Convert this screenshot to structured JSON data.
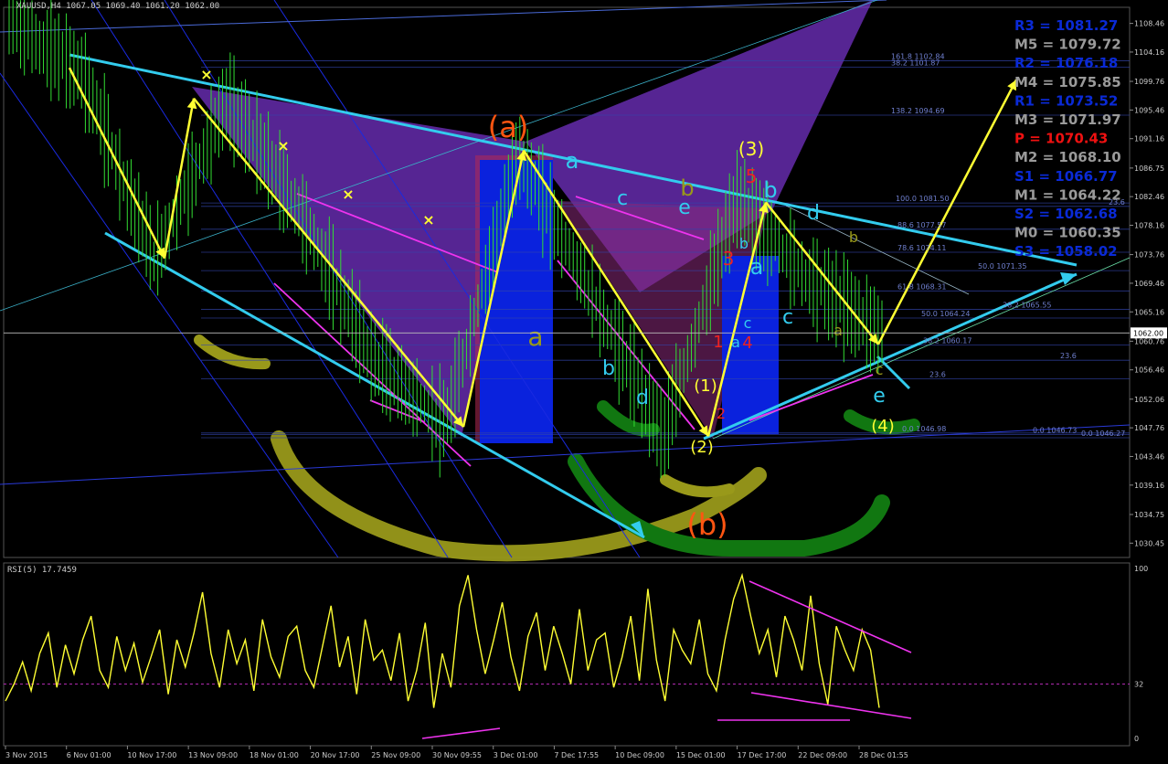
{
  "colors": {
    "background": "#000000",
    "candle": "#33dd33",
    "fib_line": "#3344aa",
    "wave_yellow": "#ffff33",
    "channel_cyan": "#33ccee",
    "magenta": "#ee33ee",
    "purple_fill": "#7733cc",
    "blue_fill": "#0a22dd",
    "olive": "#99991a",
    "dark_green": "#117711",
    "orange": "#ff5511",
    "red": "#ee2222",
    "axis_text": "#cccccc",
    "pivot_blue": "#0a2ad6",
    "pivot_gray": "#9a9a9a",
    "pivot_red": "#ee1111"
  },
  "main": {
    "header": "XAUUSD,H4  1067.05 1069.40 1061.20 1062.00",
    "current_price_label": "1062.00",
    "price_axis_labels": [
      "1108.46",
      "1104.16",
      "1099.76",
      "1095.46",
      "1091.16",
      "1086.75",
      "1082.46",
      "1078.16",
      "1073.76",
      "1069.46",
      "1065.16",
      "1060.76",
      "1056.46",
      "1052.06",
      "1047.76",
      "1043.46",
      "1039.16",
      "1034.75",
      "1030.45"
    ],
    "time_axis_labels": [
      "3 Nov 2015",
      "6 Nov 01:00",
      "10 Nov 17:00",
      "13 Nov 09:00",
      "18 Nov 01:00",
      "20 Nov 17:00",
      "25 Nov 09:00",
      "30 Nov 09:55",
      "3 Dec 01:00",
      "7 Dec 17:55",
      "10 Dec 09:00",
      "15 Dec 01:00",
      "17 Dec 17:00",
      "22 Dec 09:00",
      "28 Dec 01:55"
    ]
  },
  "fib_labels": [
    {
      "text": "161.8 1102.84",
      "price": 1102.84
    },
    {
      "text": "38.2 1101.87",
      "price": 1101.87
    },
    {
      "text": "138.2 1094.69",
      "price": 1094.69
    },
    {
      "text": "100.0 1081.50",
      "price": 1081.5
    },
    {
      "text": "23.6",
      "price": 1081.0
    },
    {
      "text": "88.6 1077.57",
      "price": 1077.57
    },
    {
      "text": "78.6 1074.11",
      "price": 1074.11
    },
    {
      "text": "50.0 1071.35",
      "price": 1071.35
    },
    {
      "text": "61.8 1068.31",
      "price": 1068.31
    },
    {
      "text": "38.2 1065.55",
      "price": 1065.55
    },
    {
      "text": "50.0 1064.24",
      "price": 1064.24
    },
    {
      "text": "38.2 1060.17",
      "price": 1060.17
    },
    {
      "text": "23.6",
      "price": 1057.9
    },
    {
      "text": "23.6",
      "price": 1055.1
    },
    {
      "text": "0.0 1046.98",
      "price": 1046.98
    },
    {
      "text": "0.0 1046.73",
      "price": 1046.73
    },
    {
      "text": "0.0 1046.27",
      "price": 1046.27
    }
  ],
  "pivots": [
    {
      "label": "R3 = 1081.27",
      "kind": "blue"
    },
    {
      "label": "M5 = 1079.72",
      "kind": "gray"
    },
    {
      "label": "R2 = 1076.18",
      "kind": "blue"
    },
    {
      "label": "M4 = 1075.85",
      "kind": "gray"
    },
    {
      "label": "R1 = 1073.52",
      "kind": "blue"
    },
    {
      "label": "M3 = 1071.97",
      "kind": "gray"
    },
    {
      "label": "P = 1070.43",
      "kind": "red"
    },
    {
      "label": "M2 = 1068.10",
      "kind": "gray"
    },
    {
      "label": "S1 = 1066.77",
      "kind": "blue"
    },
    {
      "label": "M1 = 1064.22",
      "kind": "gray"
    },
    {
      "label": "S2 = 1062.68",
      "kind": "blue"
    },
    {
      "label": "M0 = 1060.35",
      "kind": "gray"
    },
    {
      "label": "S3 = 1058.02",
      "kind": "blue"
    }
  ],
  "wave_labels": [
    {
      "text": "(a)",
      "color": "orange",
      "size": 32
    },
    {
      "text": "(b)",
      "color": "orange",
      "size": 32
    },
    {
      "text": "(3)",
      "color": "wave_yellow",
      "size": 20
    },
    {
      "text": "(4)",
      "color": "wave_yellow",
      "size": 18
    },
    {
      "text": "(1)",
      "color": "wave_yellow",
      "size": 18
    },
    {
      "text": "(2)",
      "color": "wave_yellow",
      "size": 18
    },
    {
      "text": "a",
      "color": "channel_cyan",
      "size": 24
    },
    {
      "text": "a",
      "color": "olive",
      "size": 28
    },
    {
      "text": "b",
      "color": "channel_cyan",
      "size": 22
    },
    {
      "text": "c",
      "color": "channel_cyan",
      "size": 22
    },
    {
      "text": "d",
      "color": "channel_cyan",
      "size": 22
    },
    {
      "text": "e",
      "color": "channel_cyan",
      "size": 22
    },
    {
      "text": "b",
      "color": "olive",
      "size": 24
    },
    {
      "text": "5",
      "color": "red",
      "size": 20
    },
    {
      "text": "3",
      "color": "red",
      "size": 20
    },
    {
      "text": "1",
      "color": "red",
      "size": 18
    },
    {
      "text": "4",
      "color": "red",
      "size": 18
    },
    {
      "text": "2",
      "color": "red",
      "size": 16
    },
    {
      "text": "a",
      "color": "channel_cyan",
      "size": 24
    },
    {
      "text": "b",
      "color": "channel_cyan",
      "size": 24
    },
    {
      "text": "b",
      "color": "channel_cyan",
      "size": 16
    },
    {
      "text": "c",
      "color": "channel_cyan",
      "size": 16
    },
    {
      "text": "a",
      "color": "channel_cyan",
      "size": 16
    },
    {
      "text": "c",
      "color": "channel_cyan",
      "size": 22
    },
    {
      "text": "d",
      "color": "channel_cyan",
      "size": 22
    },
    {
      "text": "b",
      "color": "olive",
      "size": 16
    },
    {
      "text": "a",
      "color": "olive",
      "size": 16
    },
    {
      "text": "c",
      "color": "olive",
      "size": 16
    },
    {
      "text": "e",
      "color": "channel_cyan",
      "size": 22
    }
  ],
  "rsi": {
    "header": "RSI(5) 17.7459",
    "axis_labels": [
      "100",
      "32",
      "0"
    ]
  },
  "chart_data": [
    {
      "type": "line",
      "name_on_chart": "XAUUSD,H4",
      "description_values": {
        "open": 1067.05,
        "high": 1069.4,
        "low": 1061.2,
        "close": 1062.0
      },
      "ylim": [
        1028.3,
        1110.6
      ],
      "x": [
        "3 Nov 2015",
        "6 Nov 01:00",
        "10 Nov 17:00",
        "13 Nov 09:00",
        "18 Nov 01:00",
        "20 Nov 17:00",
        "25 Nov 09:00",
        "30 Nov 09:55",
        "3 Dec 01:00",
        "7 Dec 17:55",
        "10 Dec 09:00",
        "15 Dec 01:00",
        "17 Dec 17:00",
        "22 Dec 09:00",
        "28 Dec 01:55"
      ],
      "price_path": [
        1108.5,
        1101.0,
        1073.0,
        1097.0,
        1080.0,
        1058.0,
        1048.0,
        1089.0,
        1068.0,
        1046.5,
        1082.0,
        1070.0,
        1062.0
      ],
      "wave_arrow_path": [
        1101.8,
        1073.2,
        1097.2,
        1047.9,
        1089.4,
        1046.5,
        1081.6,
        1060.3,
        1100.0
      ],
      "grid": false
    },
    {
      "type": "line",
      "name_on_chart": "RSI(5)",
      "last_value": 17.7459,
      "ylim": [
        0,
        100
      ],
      "levels": [
        32
      ],
      "values": [
        22,
        32,
        45,
        28,
        50,
        62,
        30,
        55,
        38,
        58,
        72,
        40,
        30,
        60,
        40,
        56,
        33,
        48,
        64,
        26,
        58,
        42,
        62,
        86,
        50,
        30,
        64,
        44,
        58,
        28,
        70,
        48,
        36,
        60,
        66,
        40,
        30,
        54,
        78,
        42,
        60,
        26,
        70,
        46,
        52,
        34,
        62,
        22,
        40,
        68,
        18,
        50,
        30,
        78,
        96,
        64,
        38,
        58,
        80,
        48,
        28,
        60,
        74,
        40,
        66,
        50,
        32,
        76,
        40,
        58,
        62,
        30,
        48,
        72,
        34,
        88,
        46,
        22,
        64,
        52,
        44,
        70,
        38,
        28,
        58,
        82,
        96,
        72,
        50,
        64,
        36,
        72,
        58,
        40,
        84,
        44,
        20,
        66,
        52,
        40,
        64,
        52,
        18
      ]
    }
  ]
}
